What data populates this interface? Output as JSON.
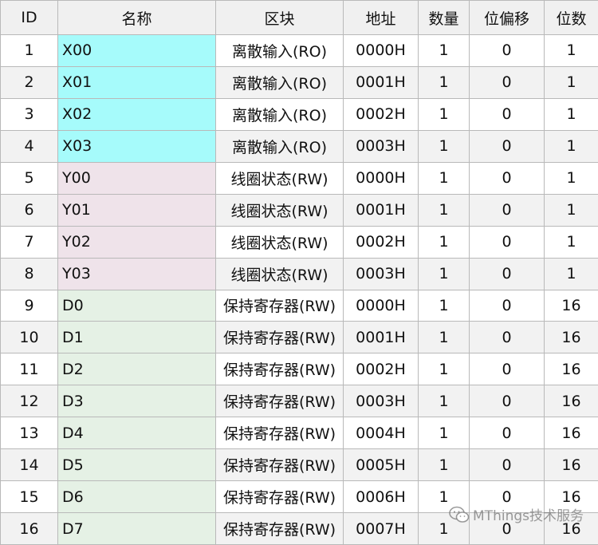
{
  "table": {
    "headers": [
      "ID",
      "名称",
      "区块",
      "地址",
      "数量",
      "位偏移",
      "位数"
    ],
    "rows": [
      {
        "id": "1",
        "name": "X00",
        "block": "离散输入(RO)",
        "addr": "0000H",
        "qty": "1",
        "offset": "0",
        "bits": "1",
        "color": "cyan"
      },
      {
        "id": "2",
        "name": "X01",
        "block": "离散输入(RO)",
        "addr": "0001H",
        "qty": "1",
        "offset": "0",
        "bits": "1",
        "color": "cyan"
      },
      {
        "id": "3",
        "name": "X02",
        "block": "离散输入(RO)",
        "addr": "0002H",
        "qty": "1",
        "offset": "0",
        "bits": "1",
        "color": "cyan"
      },
      {
        "id": "4",
        "name": "X03",
        "block": "离散输入(RO)",
        "addr": "0003H",
        "qty": "1",
        "offset": "0",
        "bits": "1",
        "color": "cyan"
      },
      {
        "id": "5",
        "name": "Y00",
        "block": "线圈状态(RW)",
        "addr": "0000H",
        "qty": "1",
        "offset": "0",
        "bits": "1",
        "color": "pink"
      },
      {
        "id": "6",
        "name": "Y01",
        "block": "线圈状态(RW)",
        "addr": "0001H",
        "qty": "1",
        "offset": "0",
        "bits": "1",
        "color": "pink"
      },
      {
        "id": "7",
        "name": "Y02",
        "block": "线圈状态(RW)",
        "addr": "0002H",
        "qty": "1",
        "offset": "0",
        "bits": "1",
        "color": "pink"
      },
      {
        "id": "8",
        "name": "Y03",
        "block": "线圈状态(RW)",
        "addr": "0003H",
        "qty": "1",
        "offset": "0",
        "bits": "1",
        "color": "pink"
      },
      {
        "id": "9",
        "name": "D0",
        "block": "保持寄存器(RW)",
        "addr": "0000H",
        "qty": "1",
        "offset": "0",
        "bits": "16",
        "color": "green"
      },
      {
        "id": "10",
        "name": "D1",
        "block": "保持寄存器(RW)",
        "addr": "0001H",
        "qty": "1",
        "offset": "0",
        "bits": "16",
        "color": "green"
      },
      {
        "id": "11",
        "name": "D2",
        "block": "保持寄存器(RW)",
        "addr": "0002H",
        "qty": "1",
        "offset": "0",
        "bits": "16",
        "color": "green"
      },
      {
        "id": "12",
        "name": "D3",
        "block": "保持寄存器(RW)",
        "addr": "0003H",
        "qty": "1",
        "offset": "0",
        "bits": "16",
        "color": "green"
      },
      {
        "id": "13",
        "name": "D4",
        "block": "保持寄存器(RW)",
        "addr": "0004H",
        "qty": "1",
        "offset": "0",
        "bits": "16",
        "color": "green"
      },
      {
        "id": "14",
        "name": "D5",
        "block": "保持寄存器(RW)",
        "addr": "0005H",
        "qty": "1",
        "offset": "0",
        "bits": "16",
        "color": "green"
      },
      {
        "id": "15",
        "name": "D6",
        "block": "保持寄存器(RW)",
        "addr": "0006H",
        "qty": "1",
        "offset": "0",
        "bits": "16",
        "color": "green"
      },
      {
        "id": "16",
        "name": "D7",
        "block": "保持寄存器(RW)",
        "addr": "0007H",
        "qty": "1",
        "offset": "0",
        "bits": "16",
        "color": "green"
      }
    ]
  },
  "colors": {
    "cyan": "#a6fbfb",
    "pink": "#efe3ea",
    "green": "#e5f1e5"
  },
  "watermark": {
    "text": "MThings技术服务",
    "icon": "wechat-icon"
  }
}
